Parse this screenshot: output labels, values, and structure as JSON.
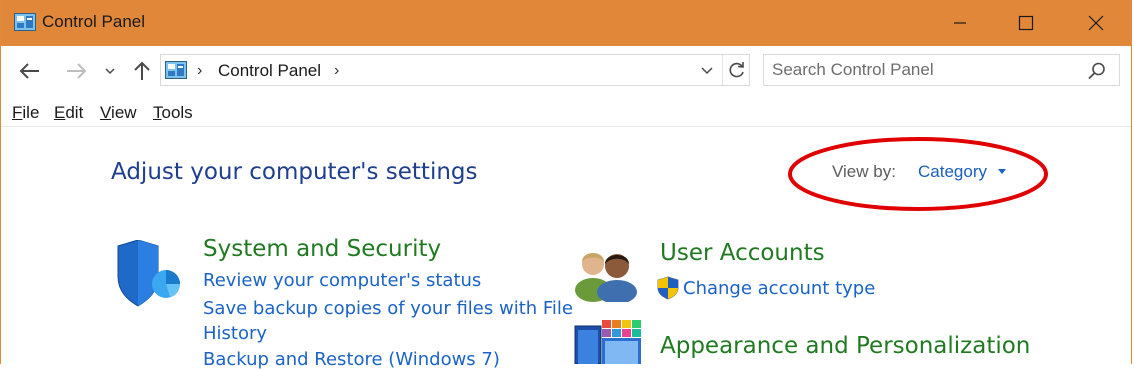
{
  "window": {
    "title": "Control Panel",
    "title_bar_color": "#e0873a"
  },
  "nav": {
    "back_icon": "arrow-left-icon",
    "forward_icon": "arrow-right-icon",
    "recent_icon": "chevron-down-icon",
    "up_icon": "arrow-up-icon"
  },
  "address": {
    "crumb": "Control Panel",
    "separator": "›"
  },
  "search": {
    "placeholder": "Search Control Panel",
    "value": ""
  },
  "menu": [
    {
      "label": "File",
      "underline": "F",
      "rest": "ile"
    },
    {
      "label": "Edit",
      "underline": "E",
      "rest": "dit"
    },
    {
      "label": "View",
      "underline": "V",
      "rest": "iew"
    },
    {
      "label": "Tools",
      "underline": "T",
      "rest": "ools"
    }
  ],
  "main": {
    "heading": "Adjust your computer's settings",
    "view_by_label": "View by:",
    "view_by_value": "Category",
    "annotation_color": "#e00000",
    "categories": [
      {
        "title": "System and Security",
        "icon": "shield-icon",
        "links": [
          "Review your computer's status",
          "Save backup copies of your files with File",
          "History",
          "Backup and Restore (Windows 7)"
        ]
      },
      {
        "title": "User Accounts",
        "icon": "users-icon",
        "links": [
          "Change account type"
        ],
        "link_icon": "uac-shield-icon"
      },
      {
        "title": "Appearance and Personalization",
        "icon": "personalization-icon",
        "links": []
      }
    ]
  },
  "colors": {
    "heading": "#1e3e8e",
    "category_title": "#217a21",
    "link": "#1b63c6"
  }
}
